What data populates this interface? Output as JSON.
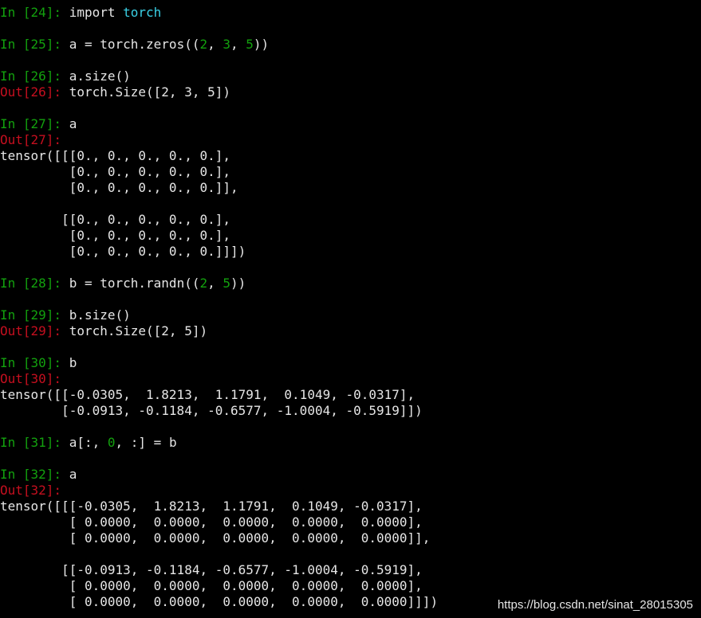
{
  "colors": {
    "background": "#000000",
    "text": "#e6e6e6",
    "in_prompt": "#13a10e",
    "out_prompt": "#c50f1f",
    "number_literal": "#13a10e",
    "module_name": "#3ad1e6"
  },
  "cells": {
    "c24": {
      "in_prompt": "In [24]: ",
      "code_a": "import ",
      "code_b": "torch"
    },
    "c25": {
      "in_prompt": "In [25]: ",
      "code_a": "a = torch.zeros((",
      "n1": "2",
      "sep1": ", ",
      "n2": "3",
      "sep2": ", ",
      "n3": "5",
      "code_end": "))"
    },
    "c26": {
      "in_prompt": "In [26]: ",
      "code": "a.size()",
      "out_prompt": "Out[26]: ",
      "output": "torch.Size([2, 3, 5])"
    },
    "c27": {
      "in_prompt": "In [27]: ",
      "code": "a",
      "out_prompt": "Out[27]:",
      "output_lines": [
        "tensor([[[0., 0., 0., 0., 0.],",
        "         [0., 0., 0., 0., 0.],",
        "         [0., 0., 0., 0., 0.]],",
        "",
        "        [[0., 0., 0., 0., 0.],",
        "         [0., 0., 0., 0., 0.],",
        "         [0., 0., 0., 0., 0.]]])"
      ]
    },
    "c28": {
      "in_prompt": "In [28]: ",
      "code_a": "b = torch.randn((",
      "n1": "2",
      "sep1": ", ",
      "n2": "5",
      "code_end": "))"
    },
    "c29": {
      "in_prompt": "In [29]: ",
      "code": "b.size()",
      "out_prompt": "Out[29]: ",
      "output": "torch.Size([2, 5])"
    },
    "c30": {
      "in_prompt": "In [30]: ",
      "code": "b",
      "out_prompt": "Out[30]:",
      "output_lines": [
        "tensor([[-0.0305,  1.8213,  1.1791,  0.1049, -0.0317],",
        "        [-0.0913, -0.1184, -0.6577, -1.0004, -0.5919]])"
      ]
    },
    "c31": {
      "in_prompt": "In [31]: ",
      "code_a": "a[:, ",
      "n1": "0",
      "code_end": ", :] = b"
    },
    "c32": {
      "in_prompt": "In [32]: ",
      "code": "a",
      "out_prompt": "Out[32]:",
      "output_lines": [
        "tensor([[[-0.0305,  1.8213,  1.1791,  0.1049, -0.0317],",
        "         [ 0.0000,  0.0000,  0.0000,  0.0000,  0.0000],",
        "         [ 0.0000,  0.0000,  0.0000,  0.0000,  0.0000]],",
        "",
        "        [[-0.0913, -0.1184, -0.6577, -1.0004, -0.5919],",
        "         [ 0.0000,  0.0000,  0.0000,  0.0000,  0.0000],",
        "         [ 0.0000,  0.0000,  0.0000,  0.0000,  0.0000]]])"
      ]
    }
  },
  "watermark": "https://blog.csdn.net/sinat_28015305"
}
